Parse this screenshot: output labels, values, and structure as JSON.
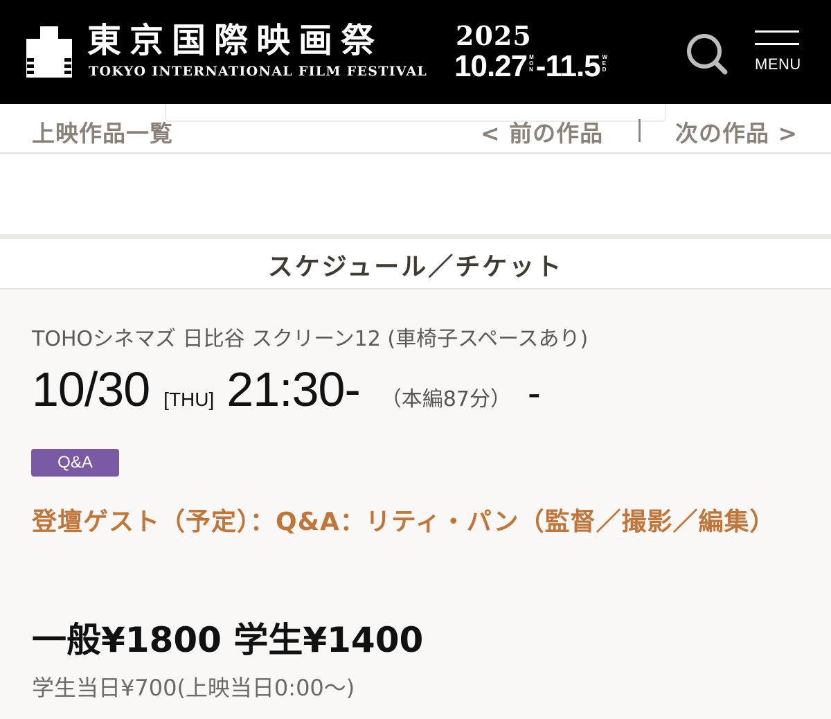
{
  "header": {
    "logo_jp": "東京国際映画祭",
    "logo_en": "TOKYO INTERNATIONAL FILM FESTIVAL",
    "year": "2025",
    "start_date": "10.27",
    "start_weekday": [
      "M",
      "O",
      "N"
    ],
    "end_separator": "-",
    "end_date": "11.5",
    "end_weekday": [
      "W",
      "E",
      "D"
    ],
    "menu_label": "MENU",
    "search_icon": "search-icon",
    "menu_icon": "hamburger-icon"
  },
  "work_nav": {
    "list_label": "上映作品一覧",
    "prev_label": "< 前の作品",
    "separator": "|",
    "next_label": "次の作品 >"
  },
  "section": {
    "title": "スケジュール／チケット"
  },
  "schedule": {
    "venue": "TOHOシネマズ 日比谷 スクリーン12 (車椅子スペースあり)",
    "date": "10/30",
    "weekday": "[THU]",
    "start_time": "21:30-",
    "runtime": "（本編87分）",
    "end_time": "-",
    "badge": "Q&A",
    "guest": "登壇ゲスト（予定）：Q&A：リティ・パン（監督／撮影／編集）",
    "price_main": "一般¥1800 学生¥1400",
    "price_student_sameday": "学生当日¥700(上映当日0:00〜)"
  },
  "colors": {
    "header_bg": "#000000",
    "badge_bg": "#7a5aa3",
    "guest_text": "#c0753a",
    "nav_text": "#8a8278"
  }
}
